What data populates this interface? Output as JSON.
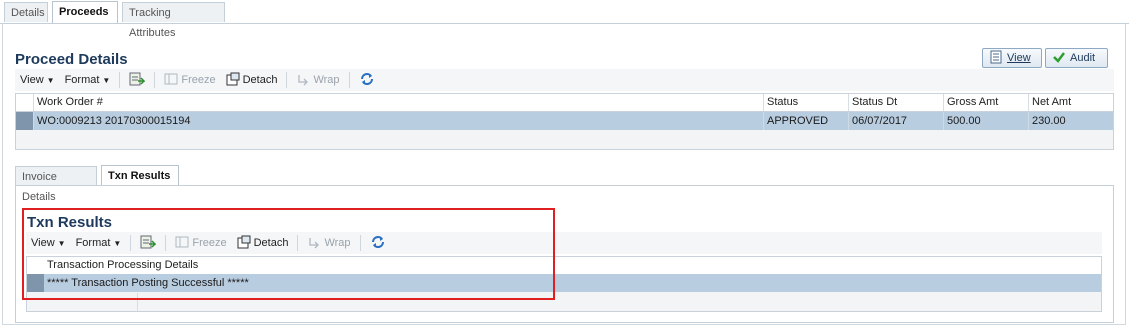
{
  "top_tabs": [
    "Details",
    "Proceeds",
    "Tracking Attributes"
  ],
  "proceed_details": {
    "title": "Proceed Details",
    "view_button": "View",
    "audit_button": "Audit",
    "toolbar": {
      "view": "View",
      "format": "Format",
      "freeze": "Freeze",
      "detach": "Detach",
      "wrap": "Wrap"
    },
    "columns": [
      "Work Order #",
      "Status",
      "Status Dt",
      "Gross Amt",
      "Net Amt"
    ],
    "rows": [
      [
        "WO:0009213 20170300015194",
        "APPROVED",
        "06/07/2017",
        "500.00",
        "230.00"
      ]
    ]
  },
  "inner_tabs": [
    "Invoice Details",
    "Txn Results"
  ],
  "txn_results": {
    "title": "Txn Results",
    "toolbar": {
      "view": "View",
      "format": "Format",
      "freeze": "Freeze",
      "detach": "Detach",
      "wrap": "Wrap"
    },
    "columns": [
      "Transaction Processing Details"
    ],
    "rows": [
      [
        "***** Transaction Posting Successful *****"
      ]
    ]
  },
  "colors": {
    "title": "#1d3a5c",
    "selected_row": "#b9cde1",
    "highlight": "#e02020"
  }
}
